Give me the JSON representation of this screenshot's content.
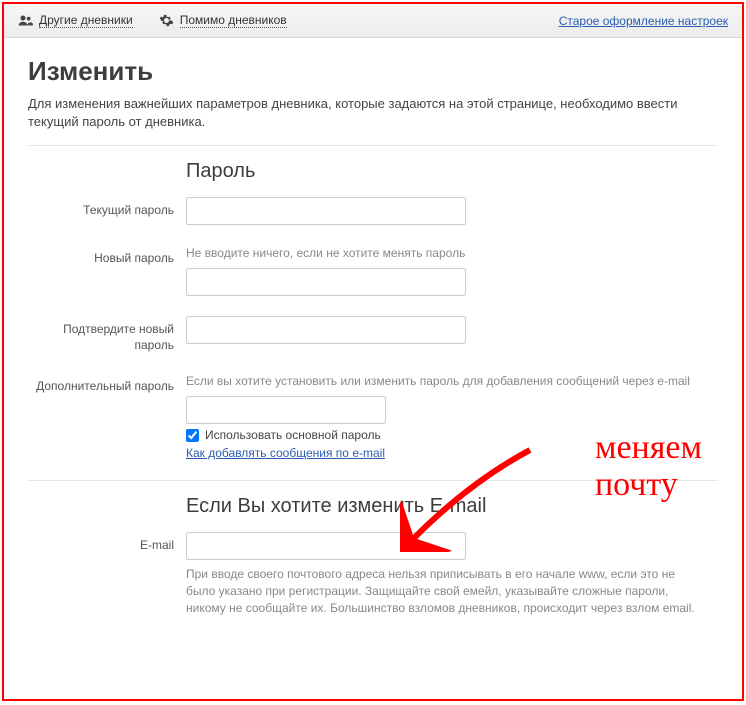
{
  "topbar": {
    "nav1": "Другие дневники",
    "nav2": "Помимо дневников",
    "right_link": "Старое оформление настроек"
  },
  "page": {
    "title": "Изменить",
    "description": "Для изменения важнейших параметров дневника, которые задаются на этой странице, необходимо ввести текущий пароль от дневника."
  },
  "password_section": {
    "title": "Пароль",
    "current_label": "Текущий пароль",
    "new_label": "Новый пароль",
    "new_placeholder": "Не вводите ничего, если не хотите менять пароль",
    "confirm_label": "Подтвердите новый пароль",
    "extra_label": "Дополнительный пароль",
    "extra_hint": "Если вы хотите установить или изменить пароль для добавления сообщений через e-mail",
    "use_main_label": "Использовать основной пароль",
    "help_link": "Как добавлять сообщения по e-mail"
  },
  "email_section": {
    "title": "Если Вы хотите изменить E-mail",
    "email_label": "E-mail",
    "email_hint": "При вводе своего почтового адреса нельзя приписывать в его начале www, если это не было указано при регистрации. Защищайте свой емейл, указывайте сложные пароли, никому не сообщайте их. Большинство взломов дневников, происходит через взлом email."
  },
  "annotation": {
    "line1": "меняем",
    "line2": "почту"
  }
}
